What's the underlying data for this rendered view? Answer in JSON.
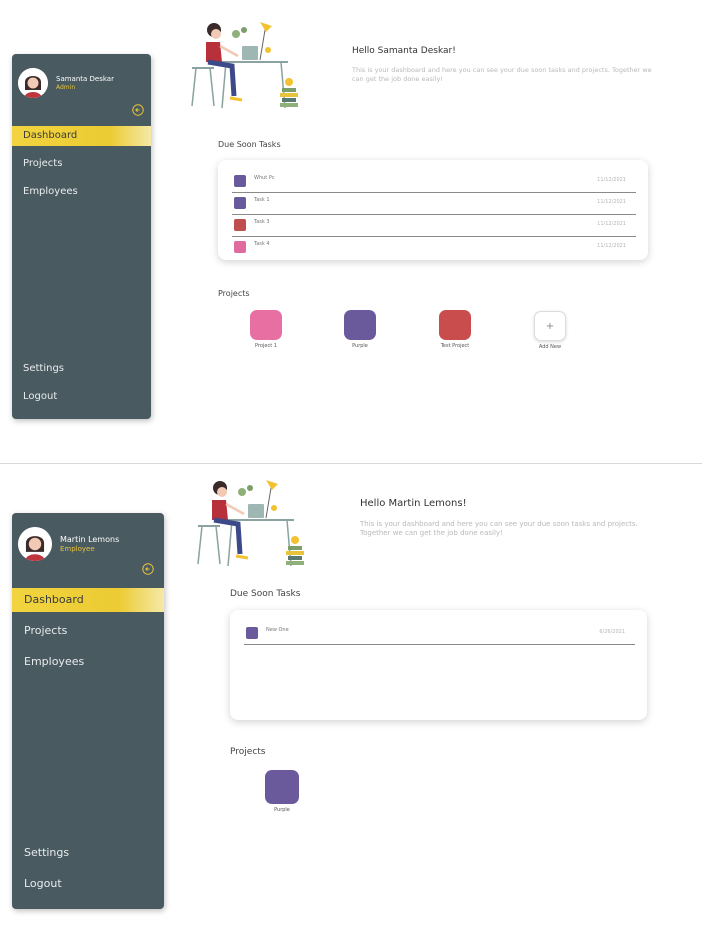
{
  "screens": [
    {
      "user": {
        "name": "Samanta Deskar",
        "role": "Admin"
      },
      "nav": {
        "dashboard": "Dashboard",
        "projects": "Projects",
        "employees": "Employees",
        "settings": "Settings",
        "logout": "Logout"
      },
      "greeting": {
        "title": "Hello Samanta Deskar!",
        "text": "This is your dashboard and here you can see your due soon tasks and projects. Together we can get the job done easily!"
      },
      "due_soon_title": "Due Soon Tasks",
      "tasks": [
        {
          "name": "Whut Pc",
          "date": "11/12/2021",
          "color": "#6a5a9c"
        },
        {
          "name": "Task 1",
          "date": "11/12/2021",
          "color": "#6a5a9c"
        },
        {
          "name": "Task 3",
          "date": "11/12/2021",
          "color": "#c04e4e"
        },
        {
          "name": "Task 4",
          "date": "11/12/2021",
          "color": "#e06b9e"
        }
      ],
      "projects_title": "Projects",
      "projects": [
        {
          "name": "Project 1",
          "color": "#e76fa2"
        },
        {
          "name": "Purple",
          "color": "#6a5a9c"
        },
        {
          "name": "Test Project",
          "color": "#c94d4d"
        }
      ],
      "add_new": {
        "label": "Add New",
        "symbol": "+"
      }
    },
    {
      "user": {
        "name": "Martin Lemons",
        "role": "Employee"
      },
      "nav": {
        "dashboard": "Dashboard",
        "projects": "Projects",
        "employees": "Employees",
        "settings": "Settings",
        "logout": "Logout"
      },
      "greeting": {
        "title": "Hello Martin Lemons!",
        "text": "This is your dashboard and here you can see your due soon tasks and projects. Together we can get the job done easily!"
      },
      "due_soon_title": "Due Soon Tasks",
      "tasks": [
        {
          "name": "New One",
          "date": "6/26/2021",
          "color": "#6a5a9c"
        }
      ],
      "projects_title": "Projects",
      "projects": [
        {
          "name": "Purple",
          "color": "#6a5a9c"
        }
      ]
    }
  ],
  "colors": {
    "sidebar": "#4a5a61",
    "accent": "#eccb33",
    "role_text": "#e7c43b"
  },
  "icons": {
    "collapse": "arrow-left-circle-icon",
    "avatar": "user-avatar-icon"
  }
}
